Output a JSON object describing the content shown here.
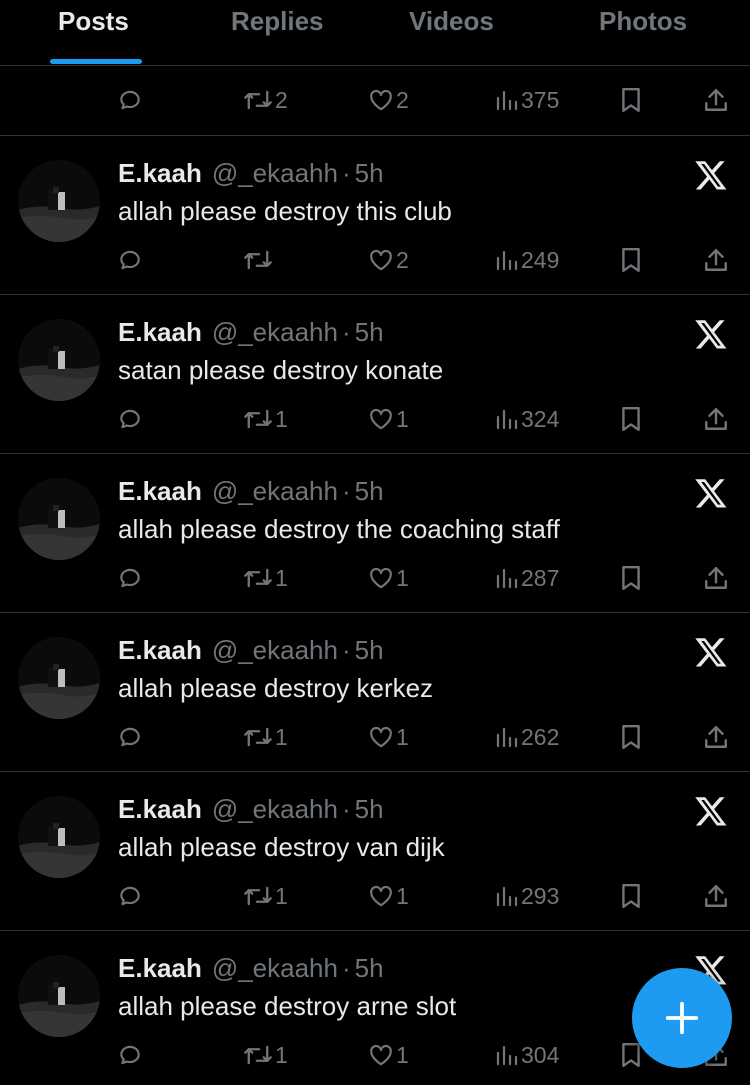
{
  "tabs": [
    {
      "label": "Posts",
      "active": true
    },
    {
      "label": "Replies",
      "active": false
    },
    {
      "label": "Videos",
      "active": false
    },
    {
      "label": "Photos",
      "active": false
    }
  ],
  "top_actions": {
    "retweets": "2",
    "likes": "2",
    "views": "375"
  },
  "tweets": [
    {
      "name": "E.kaah",
      "handle": "@_ekaahh",
      "time": "5h",
      "text": "allah please destroy this club",
      "retweets": "",
      "likes": "2",
      "views": "249"
    },
    {
      "name": "E.kaah",
      "handle": "@_ekaahh",
      "time": "5h",
      "text": "satan please destroy konate",
      "retweets": "1",
      "likes": "1",
      "views": "324"
    },
    {
      "name": "E.kaah",
      "handle": "@_ekaahh",
      "time": "5h",
      "text": "allah please destroy the coaching staff",
      "retweets": "1",
      "likes": "1",
      "views": "287"
    },
    {
      "name": "E.kaah",
      "handle": "@_ekaahh",
      "time": "5h",
      "text": "allah please destroy kerkez",
      "retweets": "1",
      "likes": "1",
      "views": "262"
    },
    {
      "name": "E.kaah",
      "handle": "@_ekaahh",
      "time": "5h",
      "text": "allah please destroy van dijk",
      "retweets": "1",
      "likes": "1",
      "views": "293"
    },
    {
      "name": "E.kaah",
      "handle": "@_ekaahh",
      "time": "5h",
      "text": "allah please destroy arne slot",
      "retweets": "1",
      "likes": "1",
      "views": "304"
    }
  ],
  "dot_separator": "·",
  "colors": {
    "background": "#000000",
    "text": "#e7e9ea",
    "muted": "#71767b",
    "accent": "#1d9bf0",
    "divider": "#2f3336"
  },
  "icons": [
    "reply-icon",
    "retweet-icon",
    "like-icon",
    "views-icon",
    "bookmark-icon",
    "share-icon",
    "x-logo-icon",
    "plus-icon"
  ]
}
